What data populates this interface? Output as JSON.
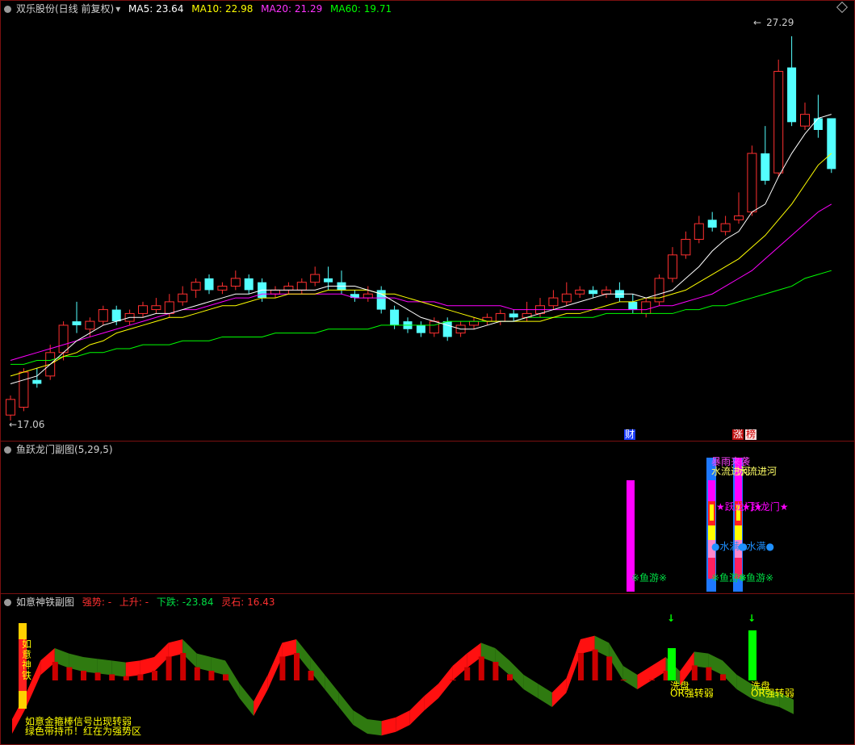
{
  "main": {
    "title": "双乐股份(日线 前复权)",
    "ma5": "MA5: 23.64",
    "ma10": "MA10: 22.98",
    "ma20": "MA20: 21.29",
    "ma60": "MA60: 19.71",
    "high_label": "27.29",
    "low_label": "17.06",
    "marker_cai": "财",
    "marker_zhang": "涨",
    "marker_bang": "榜",
    "colors": {
      "ma5": "#ffffff",
      "ma10": "#ffff00",
      "ma20": "#ff00ff",
      "ma60": "#00ff00",
      "up": "#ff3030",
      "down": "#54ffff"
    }
  },
  "sub1": {
    "title": "鱼跃龙门副图",
    "params": "(5,29,5)",
    "labels": {
      "fish_swim": "※鱼游※",
      "water_full": "●水满●",
      "jump_gate": "★跃龙门★",
      "water_flow": "水流进河",
      "rain": "暴雨来袭"
    }
  },
  "sub2": {
    "title": "如意神铁副图",
    "strong": "强势: -",
    "rise": "上升: -",
    "fall": "下跌: -23.84",
    "stone": "灵石: 16.43",
    "vertical_label": "如意神铁",
    "wash": "洗盘",
    "or_weak": "OR强转弱",
    "note1": "如意金箍棒信号出现转弱",
    "note2": "绿色带持币！红在为强势区"
  },
  "candles": [
    [
      17.2,
      17.6,
      17.06,
      17.7
    ],
    [
      17.4,
      18.3,
      17.3,
      18.4
    ],
    [
      18.1,
      18.0,
      17.9,
      18.4
    ],
    [
      18.2,
      18.8,
      18.1,
      19.0
    ],
    [
      18.8,
      19.5,
      18.6,
      19.6
    ],
    [
      19.6,
      19.5,
      19.3,
      20.1
    ],
    [
      19.4,
      19.6,
      19.2,
      19.7
    ],
    [
      19.6,
      19.9,
      19.5,
      20.0
    ],
    [
      19.9,
      19.6,
      19.5,
      20.0
    ],
    [
      19.6,
      19.8,
      19.5,
      19.9
    ],
    [
      19.8,
      20.0,
      19.7,
      20.1
    ],
    [
      19.9,
      20.0,
      19.8,
      20.2
    ],
    [
      19.8,
      20.1,
      19.7,
      20.3
    ],
    [
      20.1,
      20.3,
      20.0,
      20.5
    ],
    [
      20.4,
      20.6,
      20.2,
      20.7
    ],
    [
      20.7,
      20.4,
      20.3,
      20.8
    ],
    [
      20.4,
      20.5,
      20.3,
      20.6
    ],
    [
      20.5,
      20.7,
      20.4,
      20.9
    ],
    [
      20.7,
      20.4,
      20.3,
      20.8
    ],
    [
      20.6,
      20.2,
      20.1,
      20.7
    ],
    [
      20.3,
      20.4,
      20.2,
      20.5
    ],
    [
      20.4,
      20.5,
      20.3,
      20.6
    ],
    [
      20.4,
      20.6,
      20.3,
      20.7
    ],
    [
      20.6,
      20.8,
      20.5,
      21.0
    ],
    [
      20.7,
      20.6,
      20.4,
      21.0
    ],
    [
      20.6,
      20.4,
      20.3,
      20.9
    ],
    [
      20.3,
      20.2,
      20.1,
      20.4
    ],
    [
      20.2,
      20.3,
      20.1,
      20.5
    ],
    [
      20.4,
      19.9,
      19.8,
      20.5
    ],
    [
      19.9,
      19.5,
      19.4,
      20.0
    ],
    [
      19.6,
      19.4,
      19.3,
      19.7
    ],
    [
      19.5,
      19.3,
      19.2,
      19.6
    ],
    [
      19.3,
      19.6,
      19.2,
      19.7
    ],
    [
      19.6,
      19.2,
      19.1,
      19.7
    ],
    [
      19.3,
      19.5,
      19.2,
      19.6
    ],
    [
      19.5,
      19.6,
      19.4,
      19.7
    ],
    [
      19.6,
      19.7,
      19.5,
      19.8
    ],
    [
      19.6,
      19.8,
      19.5,
      19.9
    ],
    [
      19.8,
      19.7,
      19.6,
      19.9
    ],
    [
      19.7,
      19.8,
      19.6,
      20.1
    ],
    [
      19.8,
      20.0,
      19.7,
      20.2
    ],
    [
      20.0,
      20.2,
      19.9,
      20.4
    ],
    [
      20.1,
      20.3,
      20.0,
      20.6
    ],
    [
      20.3,
      20.4,
      20.2,
      20.5
    ],
    [
      20.4,
      20.3,
      20.2,
      20.5
    ],
    [
      20.3,
      20.4,
      20.2,
      20.5
    ],
    [
      20.4,
      20.2,
      20.1,
      20.6
    ],
    [
      20.1,
      19.9,
      19.8,
      20.3
    ],
    [
      19.8,
      20.1,
      19.7,
      20.2
    ],
    [
      20.1,
      20.7,
      20.0,
      20.8
    ],
    [
      20.7,
      21.3,
      20.6,
      21.5
    ],
    [
      21.3,
      21.7,
      21.2,
      21.9
    ],
    [
      21.7,
      22.1,
      21.6,
      22.3
    ],
    [
      22.2,
      22.0,
      21.9,
      22.4
    ],
    [
      21.9,
      22.1,
      21.8,
      22.3
    ],
    [
      22.2,
      22.3,
      22.1,
      22.9
    ],
    [
      22.4,
      23.9,
      22.3,
      24.1
    ],
    [
      23.9,
      23.2,
      23.1,
      24.6
    ],
    [
      23.4,
      26.0,
      23.3,
      26.3
    ],
    [
      26.1,
      24.7,
      24.6,
      26.9
    ],
    [
      24.6,
      24.9,
      24.5,
      25.2
    ],
    [
      24.8,
      24.5,
      24.3,
      25.4
    ],
    [
      24.8,
      23.5,
      23.4,
      24.6
    ]
  ],
  "ma": {
    "ma5": [
      18.0,
      18.1,
      18.2,
      18.5,
      18.8,
      19.1,
      19.3,
      19.5,
      19.6,
      19.7,
      19.7,
      19.8,
      19.8,
      19.9,
      20.0,
      20.1,
      20.2,
      20.3,
      20.3,
      20.4,
      20.4,
      20.4,
      20.4,
      20.4,
      20.5,
      20.5,
      20.5,
      20.4,
      20.3,
      20.1,
      19.9,
      19.7,
      19.6,
      19.5,
      19.4,
      19.4,
      19.5,
      19.6,
      19.6,
      19.7,
      19.8,
      19.9,
      20.0,
      20.1,
      20.2,
      20.3,
      20.3,
      20.3,
      20.2,
      20.3,
      20.4,
      20.7,
      21.0,
      21.4,
      21.7,
      21.9,
      22.4,
      22.6,
      23.3,
      23.9,
      24.4,
      24.8,
      24.9
    ],
    "ma10": [
      18.2,
      18.3,
      18.4,
      18.5,
      18.7,
      18.8,
      19.0,
      19.1,
      19.3,
      19.4,
      19.5,
      19.6,
      19.7,
      19.7,
      19.8,
      19.9,
      20.0,
      20.0,
      20.1,
      20.2,
      20.2,
      20.3,
      20.3,
      20.3,
      20.4,
      20.4,
      20.4,
      20.4,
      20.3,
      20.3,
      20.2,
      20.1,
      20.0,
      19.9,
      19.8,
      19.7,
      19.6,
      19.6,
      19.6,
      19.6,
      19.6,
      19.7,
      19.8,
      19.8,
      19.9,
      20.0,
      20.1,
      20.1,
      20.2,
      20.2,
      20.3,
      20.4,
      20.6,
      20.8,
      21.0,
      21.2,
      21.5,
      21.8,
      22.2,
      22.6,
      23.1,
      23.6,
      23.9
    ],
    "ma20": [
      18.6,
      18.7,
      18.8,
      18.9,
      19.0,
      19.1,
      19.2,
      19.3,
      19.4,
      19.5,
      19.6,
      19.7,
      19.8,
      19.9,
      19.9,
      20.0,
      20.1,
      20.2,
      20.2,
      20.3,
      20.3,
      20.3,
      20.3,
      20.3,
      20.3,
      20.3,
      20.2,
      20.2,
      20.2,
      20.2,
      20.1,
      20.1,
      20.1,
      20.0,
      20.0,
      20.0,
      20.0,
      20.0,
      19.9,
      19.9,
      19.9,
      19.9,
      19.9,
      19.9,
      19.9,
      19.9,
      19.9,
      19.9,
      19.9,
      20.0,
      20.0,
      20.1,
      20.2,
      20.3,
      20.5,
      20.7,
      20.9,
      21.2,
      21.5,
      21.8,
      22.1,
      22.4,
      22.6
    ],
    "ma60": [
      18.5,
      18.5,
      18.6,
      18.6,
      18.7,
      18.7,
      18.8,
      18.8,
      18.9,
      18.9,
      19.0,
      19.0,
      19.0,
      19.1,
      19.1,
      19.1,
      19.2,
      19.2,
      19.2,
      19.2,
      19.3,
      19.3,
      19.3,
      19.3,
      19.4,
      19.4,
      19.4,
      19.4,
      19.5,
      19.5,
      19.5,
      19.5,
      19.5,
      19.6,
      19.6,
      19.6,
      19.6,
      19.6,
      19.6,
      19.7,
      19.7,
      19.7,
      19.7,
      19.7,
      19.7,
      19.8,
      19.8,
      19.8,
      19.8,
      19.8,
      19.8,
      19.9,
      19.9,
      20.0,
      20.0,
      20.1,
      20.2,
      20.3,
      20.4,
      20.5,
      20.7,
      20.8,
      20.9
    ]
  },
  "sub2_values": [
    5,
    20,
    38,
    45,
    42,
    40,
    39,
    38,
    37,
    38,
    40,
    48,
    50,
    42,
    40,
    38,
    25,
    15,
    30,
    48,
    50,
    40,
    30,
    20,
    10,
    5,
    4,
    6,
    10,
    18,
    25,
    35,
    42,
    48,
    45,
    38,
    30,
    25,
    20,
    28,
    50,
    52,
    48,
    35,
    30,
    35,
    40,
    32,
    43,
    42,
    38,
    30,
    25,
    22,
    20,
    16
  ]
}
